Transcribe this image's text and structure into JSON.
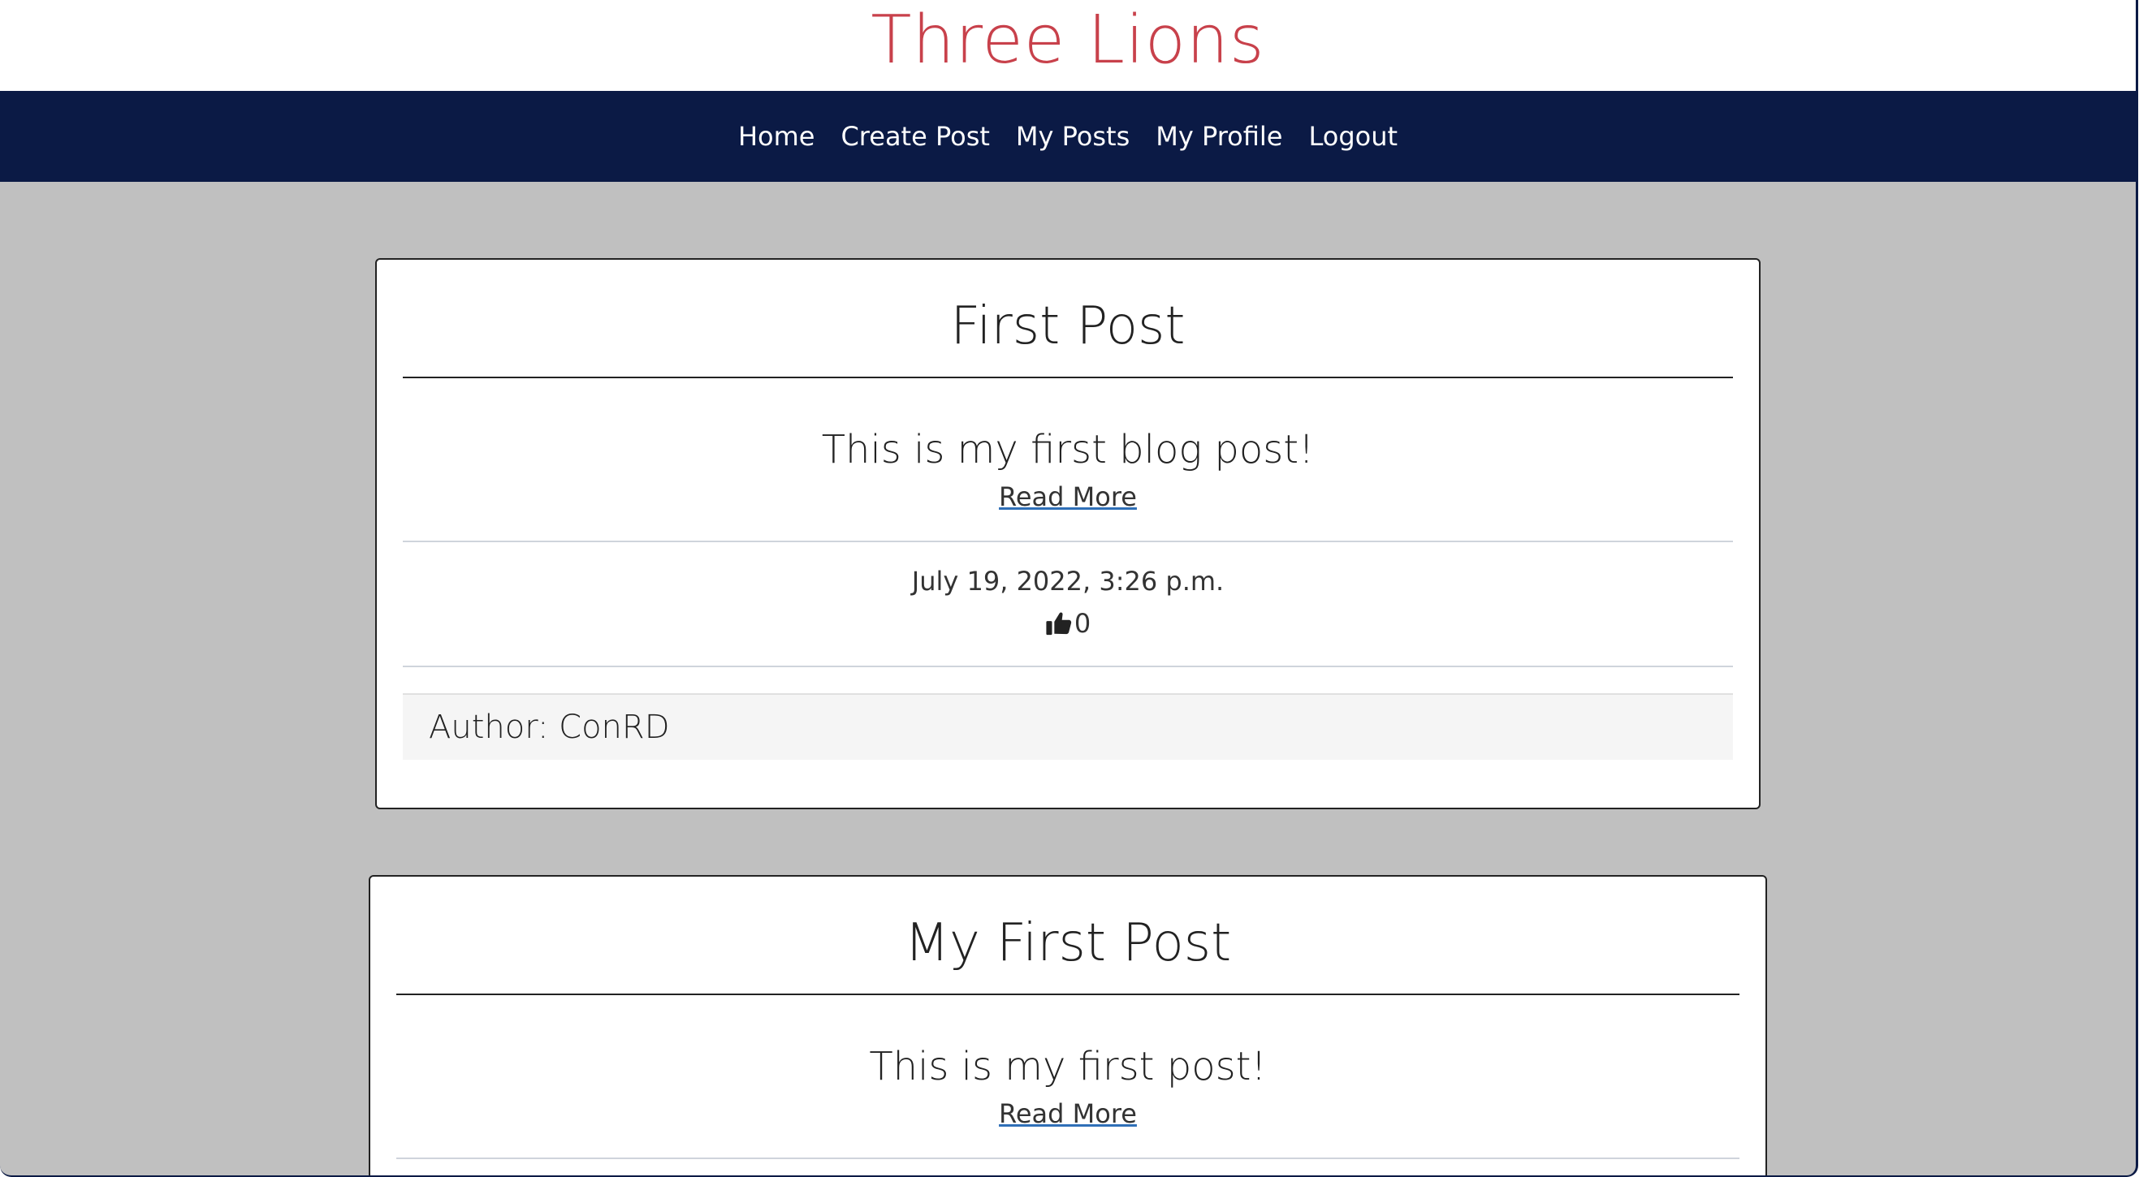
{
  "header": {
    "site_title": "Three Lions"
  },
  "nav": {
    "items": [
      {
        "label": "Home"
      },
      {
        "label": "Create Post"
      },
      {
        "label": "My Posts"
      },
      {
        "label": "My Profile"
      },
      {
        "label": "Logout"
      }
    ]
  },
  "posts": [
    {
      "title": "First Post",
      "excerpt": "This is my first blog post!",
      "read_more": "Read More",
      "date": "July 19, 2022, 3:26 p.m.",
      "likes": "0",
      "like_icon": "thumbs-up-icon",
      "author": "Author: ConRD"
    },
    {
      "title": "My First Post",
      "excerpt": "This is my first post!",
      "read_more": "Read More"
    }
  ],
  "colors": {
    "brand": "#c8414b",
    "navbar": "#0b1a45",
    "page_background": "#c0c0c0",
    "card_background": "#ffffff",
    "author_background": "#f5f5f5",
    "link_underline": "#2f6fb7"
  }
}
